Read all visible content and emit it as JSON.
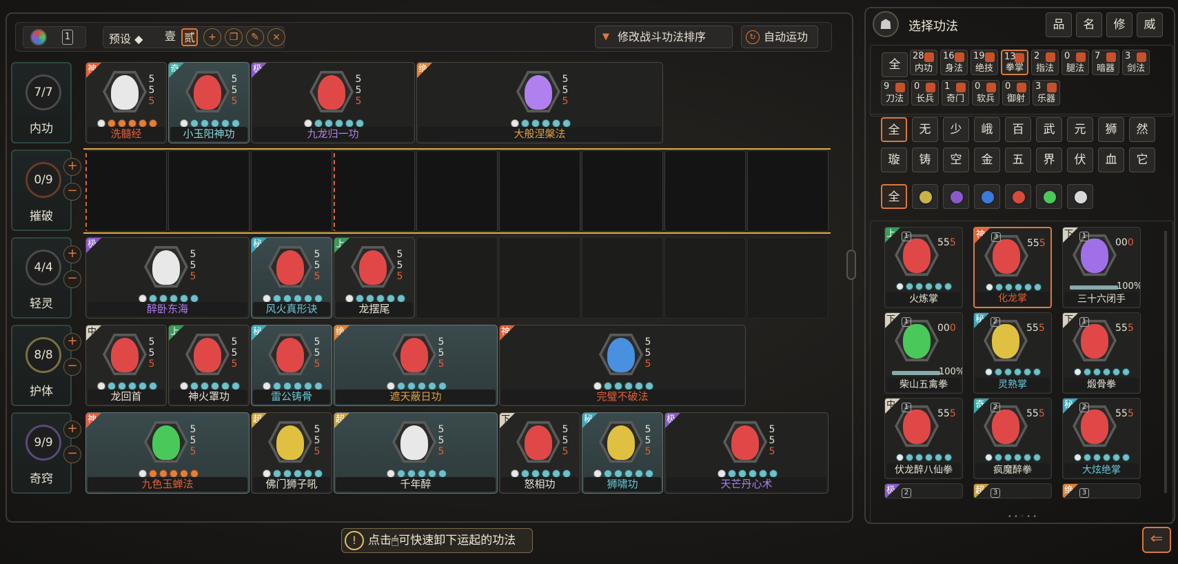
{
  "topbar": {
    "preset_label": "预设 ◆",
    "preset_1": "壹",
    "preset_2": "贰",
    "page_number": "1",
    "modify_order_button": "修改战斗功法排序",
    "auto_button": "自动运功"
  },
  "rows": [
    {
      "name": "内功",
      "count": "7/7"
    },
    {
      "name": "摧破",
      "count": "0/9"
    },
    {
      "name": "轻灵",
      "count": "4/4"
    },
    {
      "name": "护体",
      "count": "8/8"
    },
    {
      "name": "奇窍",
      "count": "9/9"
    }
  ],
  "equipped": {
    "neigong": [
      {
        "tier": "神",
        "name": "洗髓经",
        "nums": [
          "5",
          "5",
          "5"
        ]
      },
      {
        "tier": "奇",
        "name": "小玉阳神功",
        "nums": [
          "5",
          "5",
          "5"
        ]
      },
      {
        "tier": "极",
        "name": "九龙归一功",
        "nums": [
          "5",
          "5",
          "5"
        ]
      },
      {
        "tier": "绝",
        "name": "大般涅槃法",
        "nums": [
          "5",
          "5",
          "5"
        ]
      }
    ],
    "qingling": [
      {
        "tier": "极",
        "name": "醉卧东海",
        "nums": [
          "5",
          "5",
          "5"
        ]
      },
      {
        "tier": "秘",
        "name": "风火真形诀",
        "nums": [
          "5",
          "5",
          "5"
        ]
      },
      {
        "tier": "上",
        "name": "龙摆尾",
        "nums": [
          "5",
          "5",
          "5"
        ]
      }
    ],
    "huti": [
      {
        "tier": "中",
        "name": "龙回首",
        "nums": [
          "5",
          "5",
          "5"
        ]
      },
      {
        "tier": "上",
        "name": "神火罩功",
        "nums": [
          "5",
          "5",
          "5"
        ]
      },
      {
        "tier": "秘",
        "name": "雷公铸骨",
        "nums": [
          "5",
          "5",
          "5"
        ]
      },
      {
        "tier": "绝",
        "name": "遮天蔽日功",
        "nums": [
          "5",
          "5",
          "5"
        ]
      },
      {
        "tier": "神",
        "name": "完璧不破法",
        "nums": [
          "5",
          "5",
          "5"
        ]
      }
    ],
    "qiqiao": [
      {
        "tier": "神",
        "name": "九色玉蝉法",
        "nums": [
          "5",
          "5",
          "5"
        ]
      },
      {
        "tier": "超",
        "name": "佛门狮子吼",
        "nums": [
          "5",
          "5",
          "5"
        ]
      },
      {
        "tier": "超",
        "name": "千年醉",
        "nums": [
          "5",
          "5",
          "5"
        ]
      },
      {
        "tier": "下",
        "name": "怒相功",
        "nums": [
          "5",
          "5",
          "5"
        ]
      },
      {
        "tier": "秘",
        "name": "狮啸功",
        "nums": [
          "5",
          "5",
          "5"
        ]
      },
      {
        "tier": "极",
        "name": "天芒丹心术",
        "nums": [
          "5",
          "5",
          "5"
        ]
      }
    ]
  },
  "right_panel": {
    "title": "选择功法",
    "sort_buttons": [
      "品",
      "名",
      "修",
      "威"
    ],
    "all_label": "全",
    "categories": [
      {
        "count": "28",
        "label": "内功"
      },
      {
        "count": "16",
        "label": "身法"
      },
      {
        "count": "19",
        "label": "绝技"
      },
      {
        "count": "13",
        "label": "拳掌"
      },
      {
        "count": "2",
        "label": "指法"
      },
      {
        "count": "0",
        "label": "腿法"
      },
      {
        "count": "7",
        "label": "暗器"
      },
      {
        "count": "3",
        "label": "剑法"
      },
      {
        "count": "9",
        "label": "刀法"
      },
      {
        "count": "0",
        "label": "长兵"
      },
      {
        "count": "1",
        "label": "奇门"
      },
      {
        "count": "0",
        "label": "软兵"
      },
      {
        "count": "0",
        "label": "御射"
      },
      {
        "count": "3",
        "label": "乐器"
      }
    ],
    "sects_row1": [
      "全",
      "无",
      "少",
      "峨",
      "百",
      "武",
      "元",
      "狮",
      "然"
    ],
    "sects_row2": [
      "璇",
      "铸",
      "空",
      "金",
      "五",
      "界",
      "伏",
      "血",
      "它"
    ],
    "elements": [
      "全"
    ],
    "element_colors": [
      "#c9b24a",
      "#8a5ac8",
      "#3a7ad8",
      "#d84a3a",
      "#4ac85a",
      "#d8d8d8"
    ],
    "grid": [
      {
        "tier": "上",
        "lvl": "1",
        "name": "火炼掌",
        "nums": [
          "5",
          "5",
          "5"
        ],
        "pct": ""
      },
      {
        "tier": "神",
        "lvl": "3",
        "name": "化龙掌",
        "nums": [
          "5",
          "5",
          "5"
        ],
        "pct": ""
      },
      {
        "tier": "下",
        "lvl": "1",
        "name": "三十六闭手",
        "nums": [
          "0",
          "0",
          "0"
        ],
        "pct": "100%"
      },
      {
        "tier": "下",
        "lvl": "1",
        "name": "柴山五禽拳",
        "nums": [
          "0",
          "0",
          "0"
        ],
        "pct": "100%"
      },
      {
        "tier": "秘",
        "lvl": "2",
        "name": "灵熟掌",
        "nums": [
          "5",
          "5",
          "5"
        ],
        "pct": ""
      },
      {
        "tier": "下",
        "lvl": "1",
        "name": "煅骨拳",
        "nums": [
          "5",
          "5",
          "5"
        ],
        "pct": ""
      },
      {
        "tier": "中",
        "lvl": "1",
        "name": "伏龙醉八仙拳",
        "nums": [
          "5",
          "5",
          "5"
        ],
        "pct": ""
      },
      {
        "tier": "奇",
        "lvl": "2",
        "name": "疯魔醉拳",
        "nums": [
          "5",
          "5",
          "5"
        ],
        "pct": ""
      },
      {
        "tier": "秘",
        "lvl": "2",
        "name": "大炫绝掌",
        "nums": [
          "5",
          "5",
          "5"
        ],
        "pct": ""
      }
    ],
    "partial_tiers": [
      "极",
      "超",
      "绝"
    ],
    "partial_lvls": [
      "2",
      "3",
      "3"
    ]
  },
  "tip": {
    "text": "点击🖱可快速卸下运起的功法"
  },
  "colors": {
    "orange": "#e0603a",
    "purple": "#b080f0",
    "teal": "#4ab8c8",
    "gold": "#e0a040"
  }
}
